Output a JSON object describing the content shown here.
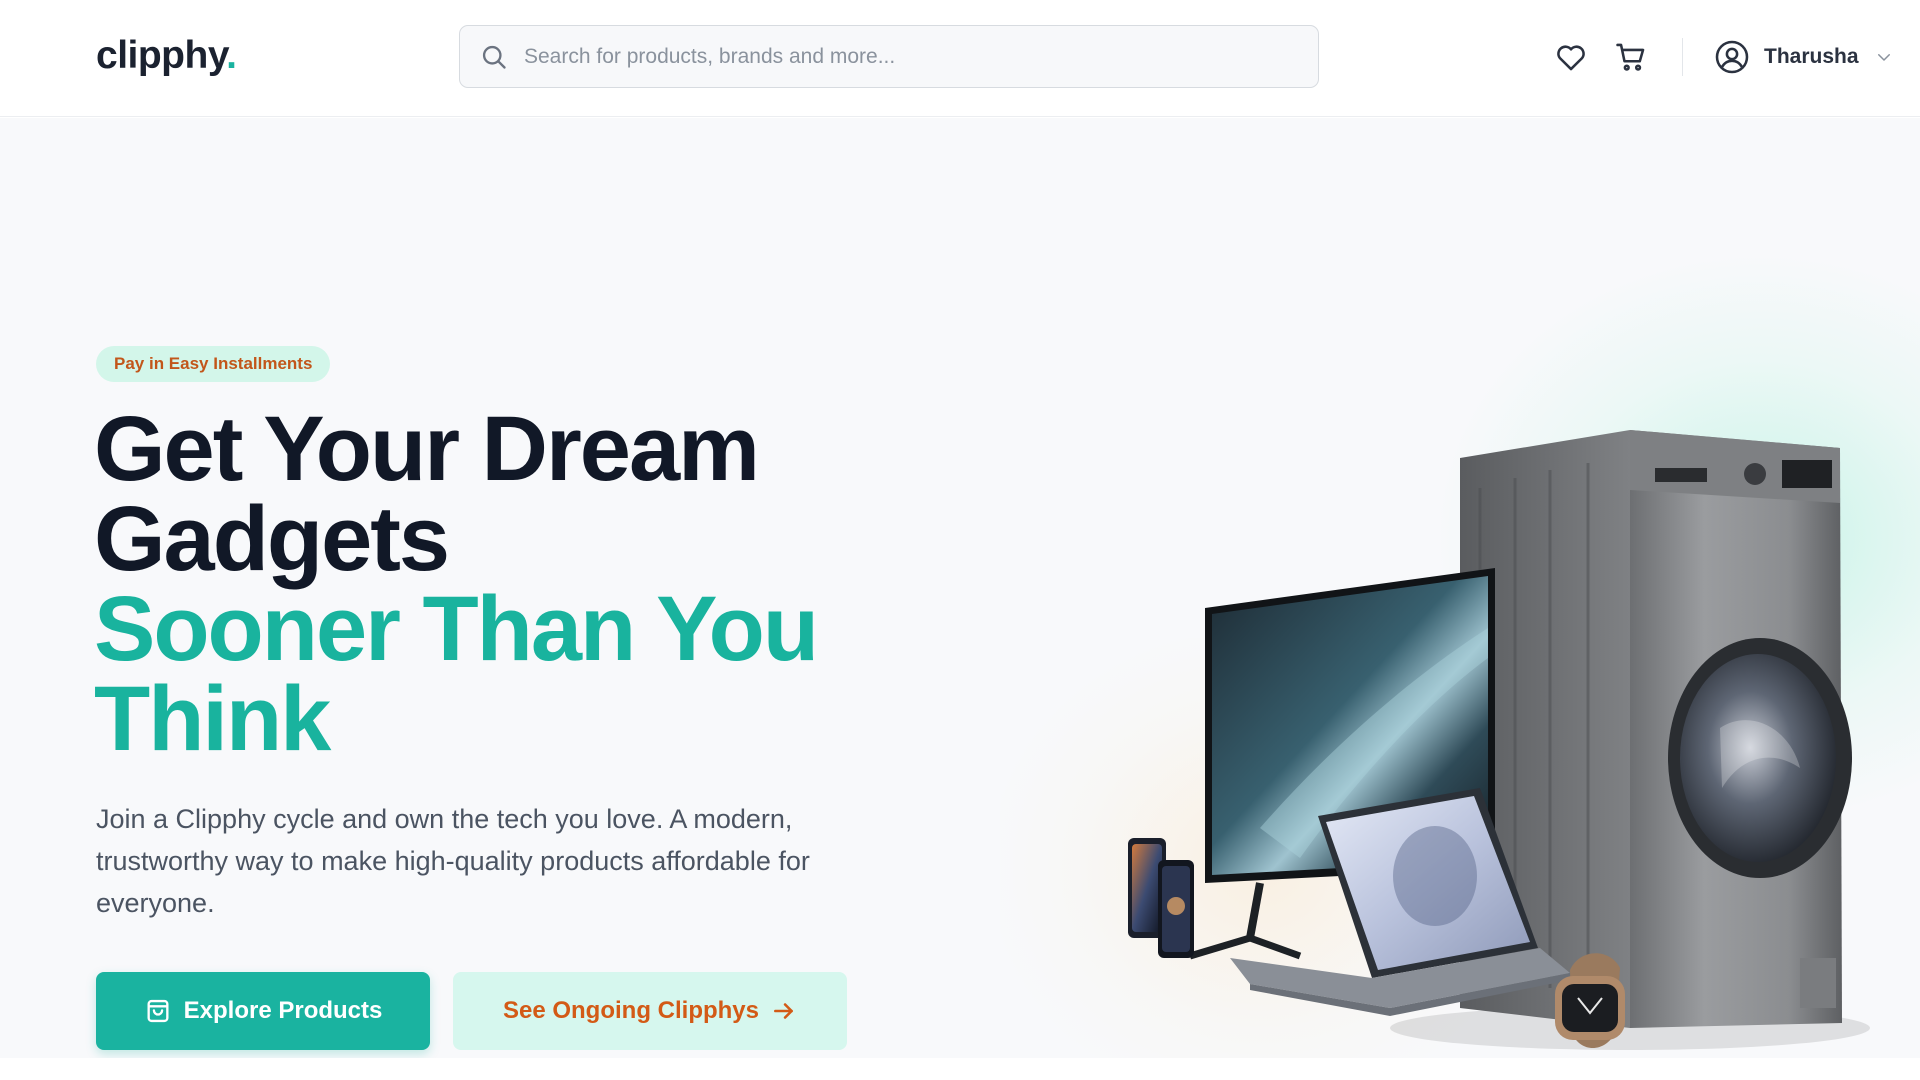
{
  "header": {
    "logo_text": "clipphy",
    "logo_dot": ".",
    "search_placeholder": "Search for products, brands and more...",
    "wishlist_icon": "heart-icon",
    "cart_icon": "cart-icon",
    "user_name": "Tharusha",
    "user_icon": "user-circle-icon",
    "user_menu_icon": "chevron-down-icon"
  },
  "hero": {
    "badge": "Pay in Easy Installments",
    "headline_line1": "Get Your Dream",
    "headline_line2": "Gadgets",
    "headline_line3": "Sooner Than You",
    "headline_line4": "Think",
    "description": "Join a Clipphy cycle and own the tech you love. A modern, trustworthy way to make high-quality products affordable for everyone.",
    "primary_button": "Explore Products",
    "primary_button_icon": "shopping-bag-icon",
    "secondary_button": "See Ongoing Clipphys",
    "secondary_button_icon": "arrow-right-icon",
    "image_subject": "gadgets-illustration"
  },
  "colors": {
    "brand_teal": "#1ab3a0",
    "headline_dark": "#111827",
    "accent_orange": "#d35a16",
    "badge_bg": "#d3f6ea"
  }
}
